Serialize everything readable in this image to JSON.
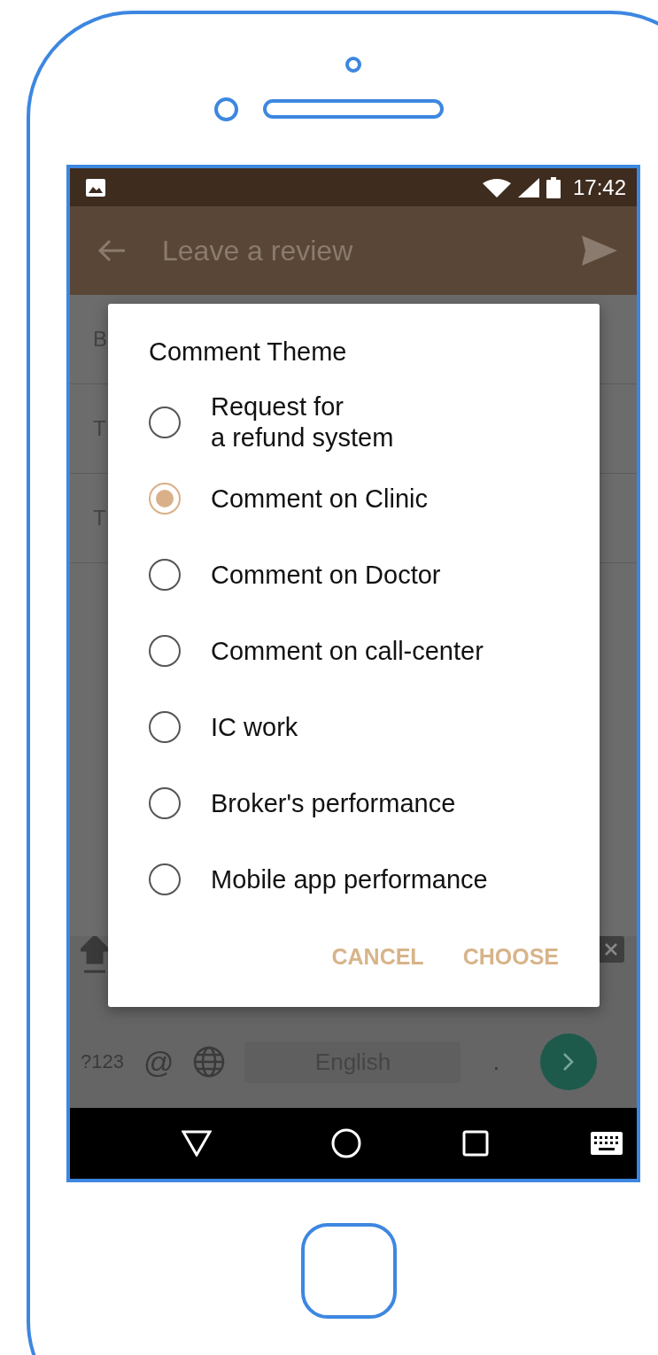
{
  "status_bar": {
    "time": "17:42"
  },
  "app_bar": {
    "title": "Leave a review"
  },
  "background_fields": [
    {
      "label": "B"
    },
    {
      "label": "T"
    },
    {
      "label": "T"
    }
  ],
  "dialog": {
    "title": "Comment Theme",
    "options": [
      {
        "label": "Request for\na refund system",
        "selected": false
      },
      {
        "label": "Comment on Clinic",
        "selected": true
      },
      {
        "label": "Comment on Doctor",
        "selected": false
      },
      {
        "label": "Comment on call-center",
        "selected": false
      },
      {
        "label": "IC work",
        "selected": false
      },
      {
        "label": "Broker's performance",
        "selected": false
      },
      {
        "label": "Mobile app performance",
        "selected": false
      }
    ],
    "buttons": [
      "CANCEL",
      "CHOOSE"
    ]
  },
  "keyboard": {
    "symbols_key": "?123",
    "at_key": "@",
    "space_key": "English",
    "period_key": "."
  }
}
